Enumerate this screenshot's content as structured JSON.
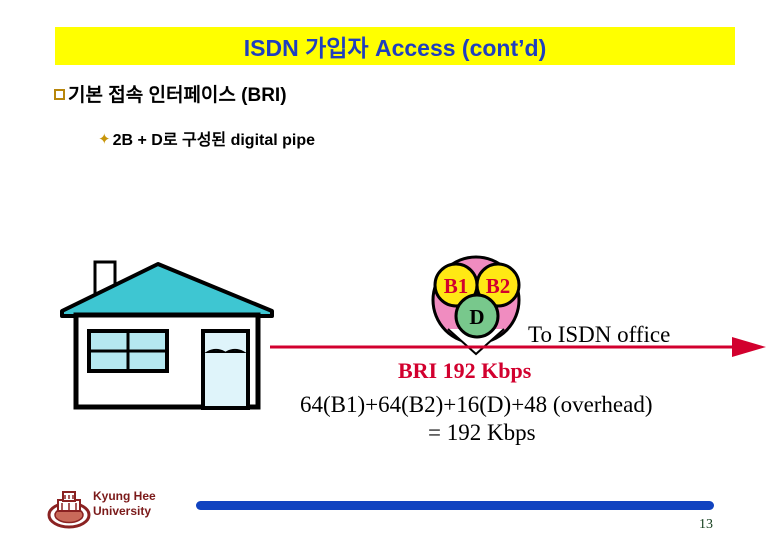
{
  "slide": {
    "title": "ISDN 가입자 Access (cont’d)",
    "title_bg_color": "#FFFF00",
    "title_text_color": "#1F3FBF"
  },
  "bullets": [
    {
      "marker": "square-bullet-icon",
      "text": "기본 접속 인터페이스 (BRI)",
      "level": 1
    },
    {
      "marker": "diamond-bullet-icon",
      "text": "2B + D로 구성된 digital pipe",
      "level": 2
    }
  ],
  "diagram": {
    "house": {
      "name": "subscriber-house",
      "roof_color": "#3EC6D2",
      "wall_color": "#FFFFFF",
      "outline_color": "#000000",
      "window_color": "#B5E8F0",
      "door_color": "#DFF4FA",
      "door_fan_color": "#1E9BB5"
    },
    "pipe": {
      "outer_circle_color": "#F08CC0",
      "channels": [
        {
          "label": "B1",
          "fill": "#FFE814",
          "text_color": "#D2002E"
        },
        {
          "label": "B2",
          "fill": "#FFE814",
          "text_color": "#D2002E"
        },
        {
          "label": "D",
          "fill": "#78C88C",
          "text_color": "#000000"
        }
      ]
    },
    "arrow": {
      "name": "to-isdn-office-arrow",
      "color": "#D2002E",
      "label": "To ISDN office"
    },
    "rate_label": "BRI 192 Kbps",
    "rate_label_color": "#D2002E",
    "formula_line1": "64(B1)+64(B2)+16(D)+48 (overhead)",
    "formula_line2": "= 192 Kbps"
  },
  "footer": {
    "logo": "kyung-hee-university-emblem",
    "university_line1": "Kyung Hee",
    "university_line2": "University",
    "university_color": "#7B1A1A",
    "bar_color": "#1143C0",
    "page_number": "13",
    "page_number_color": "#16401E"
  }
}
